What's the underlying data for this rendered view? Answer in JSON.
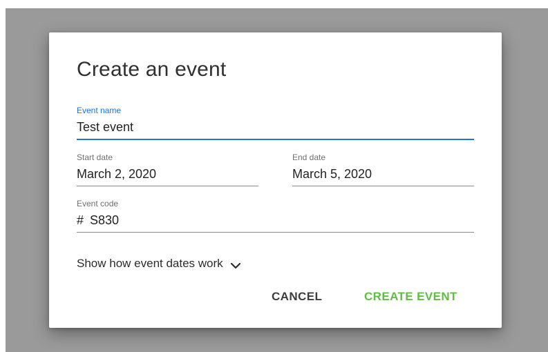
{
  "dialog": {
    "title": "Create an event",
    "fields": {
      "event_name": {
        "label": "Event name",
        "value": "Test event"
      },
      "start_date": {
        "label": "Start date",
        "value": "March 2, 2020"
      },
      "end_date": {
        "label": "End date",
        "value": "March 5, 2020"
      },
      "event_code": {
        "label": "Event code",
        "prefix": "#",
        "value": "S830"
      }
    },
    "show_dates_link": "Show how event dates work",
    "show_dates_icon": "chevron-down-icon",
    "actions": {
      "cancel_label": "CANCEL",
      "create_label": "CREATE EVENT"
    }
  },
  "colors": {
    "backdrop": "#9a9a9a",
    "focus_accent": "#1a73e8",
    "primary_action": "#5cbf3d",
    "secondary_action": "#3d3d3d"
  }
}
